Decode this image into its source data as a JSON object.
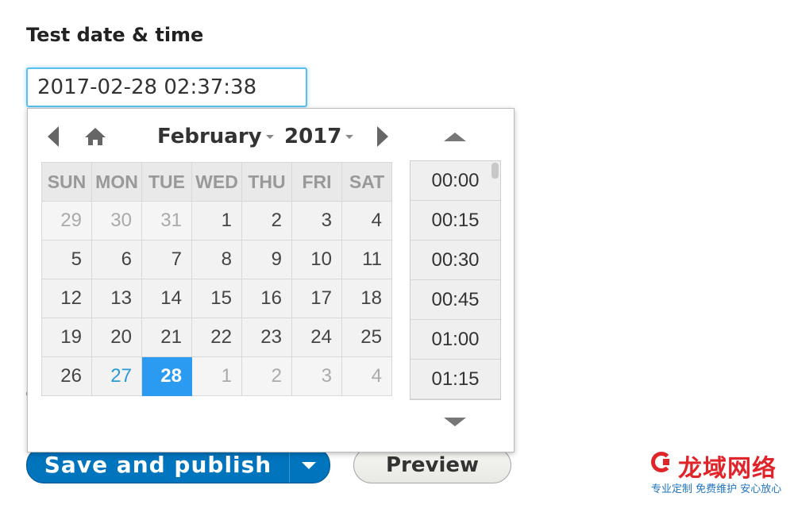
{
  "field": {
    "label": "Test date & time",
    "value": "2017-02-28 02:37:38"
  },
  "datepicker": {
    "month": "February",
    "year": "2017",
    "weekdays": [
      "SUN",
      "MON",
      "TUE",
      "WED",
      "THU",
      "FRI",
      "SAT"
    ],
    "weeks": [
      [
        {
          "d": "29",
          "s": "other"
        },
        {
          "d": "30",
          "s": "other"
        },
        {
          "d": "31",
          "s": "other"
        },
        {
          "d": "1",
          "s": ""
        },
        {
          "d": "2",
          "s": ""
        },
        {
          "d": "3",
          "s": ""
        },
        {
          "d": "4",
          "s": ""
        }
      ],
      [
        {
          "d": "5",
          "s": ""
        },
        {
          "d": "6",
          "s": ""
        },
        {
          "d": "7",
          "s": ""
        },
        {
          "d": "8",
          "s": ""
        },
        {
          "d": "9",
          "s": ""
        },
        {
          "d": "10",
          "s": ""
        },
        {
          "d": "11",
          "s": ""
        }
      ],
      [
        {
          "d": "12",
          "s": ""
        },
        {
          "d": "13",
          "s": ""
        },
        {
          "d": "14",
          "s": ""
        },
        {
          "d": "15",
          "s": ""
        },
        {
          "d": "16",
          "s": ""
        },
        {
          "d": "17",
          "s": ""
        },
        {
          "d": "18",
          "s": ""
        }
      ],
      [
        {
          "d": "19",
          "s": ""
        },
        {
          "d": "20",
          "s": ""
        },
        {
          "d": "21",
          "s": ""
        },
        {
          "d": "22",
          "s": ""
        },
        {
          "d": "23",
          "s": ""
        },
        {
          "d": "24",
          "s": ""
        },
        {
          "d": "25",
          "s": ""
        }
      ],
      [
        {
          "d": "26",
          "s": ""
        },
        {
          "d": "27",
          "s": "today"
        },
        {
          "d": "28",
          "s": "selected"
        },
        {
          "d": "1",
          "s": "other"
        },
        {
          "d": "2",
          "s": "other"
        },
        {
          "d": "3",
          "s": "other"
        },
        {
          "d": "4",
          "s": "other"
        }
      ]
    ],
    "times": [
      "00:00",
      "00:15",
      "00:30",
      "00:45",
      "01:00",
      "01:15"
    ],
    "icons": {
      "prev": "chevron-left-icon",
      "home": "home-icon",
      "next": "chevron-right-icon",
      "up": "chevron-up-icon",
      "down": "chevron-down-icon"
    }
  },
  "actions": {
    "save_label": "Save and publish",
    "preview_label": "Preview"
  },
  "watermark": {
    "title": "龙域网络",
    "subtitle": "专业定制 免费维护 安心放心"
  },
  "colors": {
    "selected": "#2a9bf0",
    "today": "#2a9ad8",
    "primary_button": "#0074bd",
    "focus_border": "#5bc0f0",
    "watermark_red": "#e0252a",
    "watermark_blue": "#1f74c0"
  }
}
